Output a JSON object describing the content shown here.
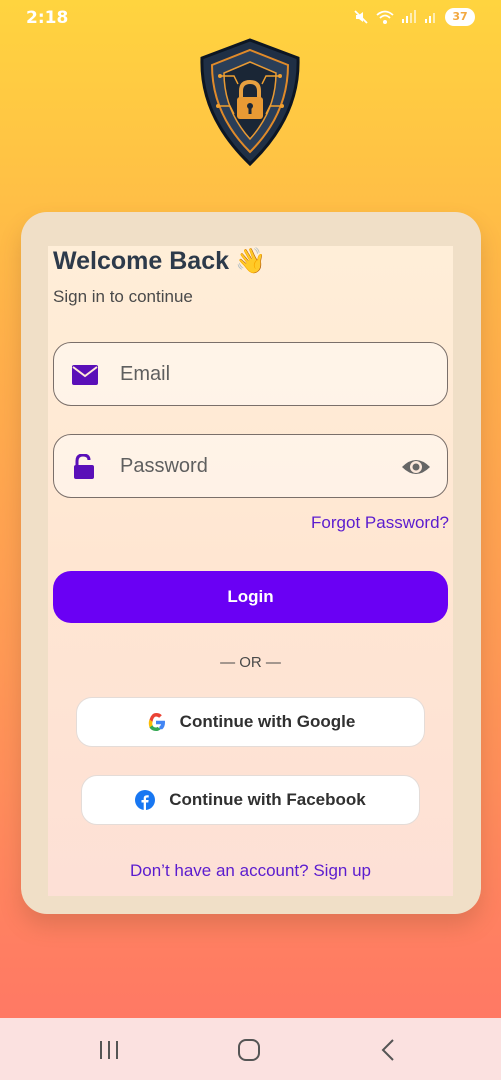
{
  "status_bar": {
    "time": "2:18",
    "battery": "37"
  },
  "login_card": {
    "title": "Welcome Back",
    "wave_emoji": "👋",
    "subtitle": "Sign in to continue",
    "email_placeholder": "Email",
    "password_placeholder": "Password",
    "forgot_password": "Forgot Password?",
    "login_button": "Login",
    "divider": "— OR —",
    "google_button": "Continue with Google",
    "facebook_button": "Continue with Facebook",
    "signup_link": "Don’t have an account? Sign up"
  },
  "icons": {
    "logo": "shield-lock-logo",
    "email": "mail-icon",
    "password": "unlock-icon",
    "visibility": "eye-icon",
    "google": "google-icon",
    "facebook": "facebook-icon"
  },
  "colors": {
    "accent": "#6a00f4",
    "link": "#5b1ccf",
    "background_top": "#ffd43f",
    "background_bottom": "#ff7466"
  }
}
